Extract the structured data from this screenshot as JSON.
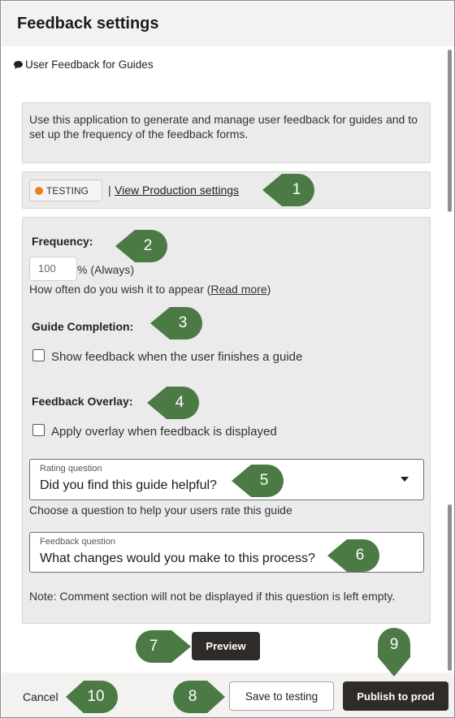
{
  "header": {
    "title": "Feedback settings"
  },
  "app": {
    "title": "User Feedback for Guides",
    "icon": "chat-icon"
  },
  "description": "Use this application to generate and manage user feedback for guides and to set up the frequency of the feedback forms.",
  "environment": {
    "badge": "TESTING",
    "badge_color": "#f07f1e",
    "separator": "|",
    "link": "View Production settings"
  },
  "frequency": {
    "label": "Frequency:",
    "value": "100",
    "unit": "% (Always)",
    "help_prefix": "How often do you wish it to appear (",
    "help_link": "Read more",
    "help_suffix": ")"
  },
  "guide_completion": {
    "label": "Guide Completion:",
    "checkbox_label": "Show feedback when the user finishes a guide"
  },
  "feedback_overlay": {
    "label": "Feedback Overlay:",
    "checkbox_label": "Apply overlay when feedback is displayed"
  },
  "rating_question": {
    "label": "Rating question",
    "value": "Did you find this guide helpful?",
    "help": "Choose a question to help your users rate this guide"
  },
  "feedback_question": {
    "label": "Feedback question",
    "value": "What changes would you make to this process?",
    "note": "Note: Comment section will not be displayed if this question is left empty."
  },
  "actions": {
    "preview": "Preview",
    "cancel": "Cancel",
    "save": "Save to testing",
    "publish": "Publish to prod"
  },
  "callouts": [
    "1",
    "2",
    "3",
    "4",
    "5",
    "6",
    "7",
    "8",
    "9",
    "10"
  ],
  "colors": {
    "callout": "#4b7a45",
    "dark_button": "#2e2b29",
    "panel": "#ebebeb"
  }
}
